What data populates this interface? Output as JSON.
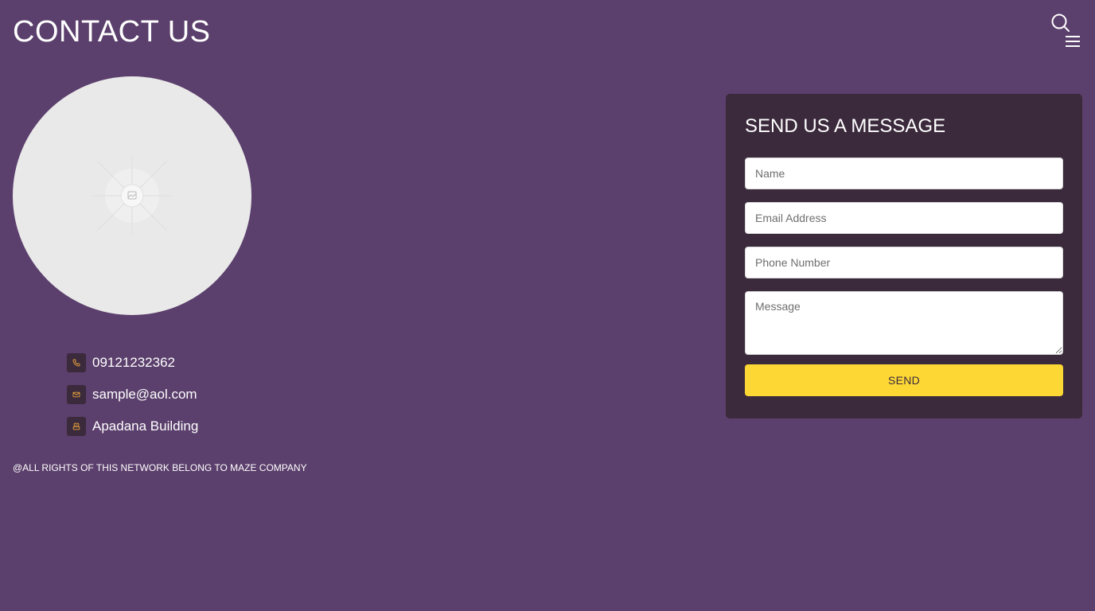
{
  "header": {
    "title": "CONTACT US",
    "search_icon": "search-icon",
    "menu_icon": "hamburger-menu-icon"
  },
  "hero": {
    "image_icon": "image-placeholder-icon"
  },
  "contacts": [
    {
      "icon": "phone-icon",
      "text": "09121232362"
    },
    {
      "icon": "mail-icon",
      "text": "sample@aol.com"
    },
    {
      "icon": "building-icon",
      "text": "Apadana Building"
    }
  ],
  "footer": {
    "copyright": "@ALL RIGHTS OF THIS NETWORK BELONG TO MAZE COMPANY"
  },
  "form": {
    "title": "SEND US A MESSAGE",
    "name_placeholder": "Name",
    "email_placeholder": "Email Address",
    "phone_placeholder": "Phone Number",
    "message_placeholder": "Message",
    "send_label": "SEND"
  },
  "colors": {
    "background": "#5b3f6c",
    "card": "#3b2a3c",
    "accent": "#fdd835",
    "icon_accent": "#e8a33d"
  }
}
